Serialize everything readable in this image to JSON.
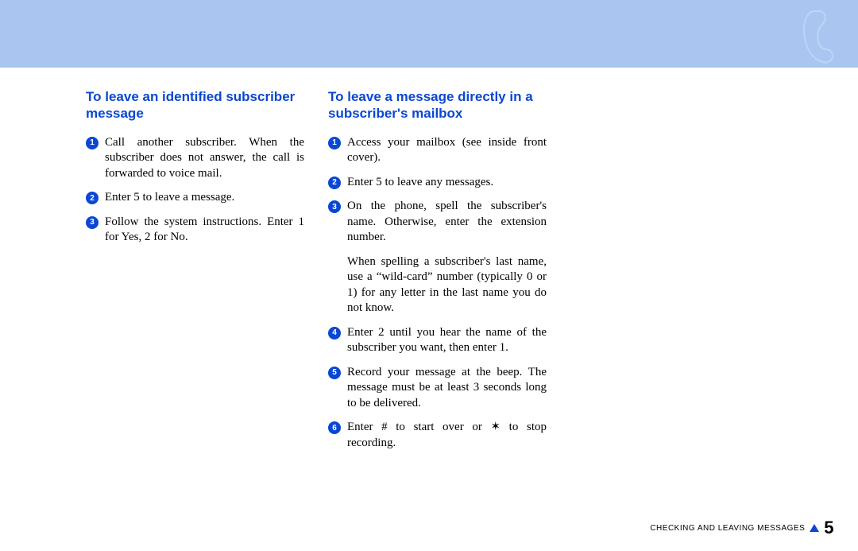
{
  "left": {
    "heading": "To leave an identified subscriber message",
    "steps": [
      "Call another subscriber. When the subscriber does not answer, the call is forwarded to voice mail.",
      "Enter 5 to leave a message.",
      "Follow the system instructions. Enter 1 for Yes, 2 for No."
    ]
  },
  "right": {
    "heading": "To leave a message directly in a subscriber's mailbox",
    "steps": [
      "Access your mailbox (see inside front cover).",
      "Enter 5 to leave any messages.",
      "On the phone, spell the subscriber's name. Otherwise, enter the exten­sion number."
    ],
    "note": "When spelling a subscriber's last name, use a “wild-card” number (typically 0 or 1) for any letter in the last name you do not know.",
    "steps2": [
      "Enter 2 until you hear the name of the subscriber you want, then enter 1.",
      "Record your message at the beep. The message must be at least 3 sec­onds long to be delivered.",
      "Enter # to start over or ✶ to stop recording."
    ]
  },
  "footer": {
    "section": "CHECKING AND LEAVING MESSAGES",
    "page": "5"
  }
}
